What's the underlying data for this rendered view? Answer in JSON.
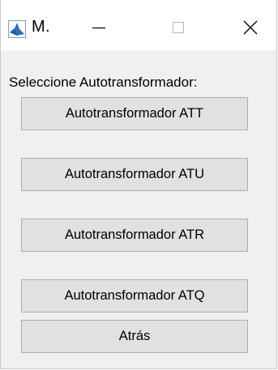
{
  "window": {
    "title": "M.",
    "controls": {
      "minimize_icon": "minimize-icon",
      "maximize_icon": "maximize-icon",
      "close_icon": "close-icon"
    },
    "app_icon": "matlab-icon"
  },
  "main": {
    "prompt": "Seleccione Autotransformador:",
    "buttons": [
      {
        "label": "Autotransformador ATT"
      },
      {
        "label": "Autotransformador ATU"
      },
      {
        "label": "Autotransformador ATR"
      },
      {
        "label": "Autotransformador ATQ"
      },
      {
        "label": "Atrás"
      }
    ]
  },
  "colors": {
    "background": "#f0f0f0",
    "button_face": "#e1e1e1",
    "button_border": "#adadad",
    "icon_accent": "#1f5fa8",
    "icon_warm": "#e0561c"
  }
}
